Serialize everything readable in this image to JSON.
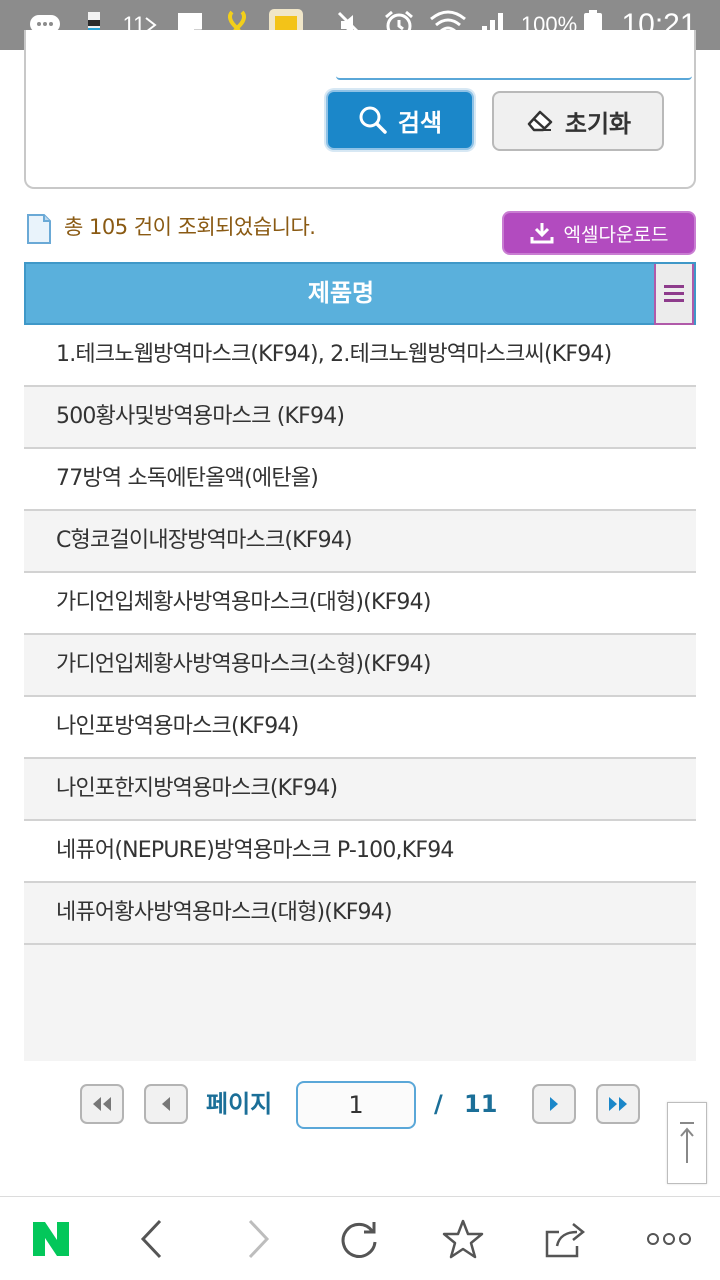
{
  "status_bar": {
    "carrier_badge": "11",
    "battery_percent": "100%",
    "time": "10:21"
  },
  "search": {
    "search_button": "검색",
    "reset_button": "초기화"
  },
  "results": {
    "summary": "총 105 건이 조회되었습니다.",
    "excel_button": "엑셀다운로드"
  },
  "table": {
    "header": "제품명",
    "rows": [
      "1.테크노웹방역마스크(KF94), 2.테크노웹방역마스크씨(KF94)",
      "500황사및방역용마스크 (KF94)",
      "77방역 소독에탄올액(에탄올)",
      "C형코걸이내장방역마스크(KF94)",
      "가디언입체황사방역용마스크(대형)(KF94)",
      "가디언입체황사방역용마스크(소형)(KF94)",
      "나인포방역용마스크(KF94)",
      "나인포한지방역용마스크(KF94)",
      "네퓨어(NEPURE)방역용마스크 P-100,KF94",
      "네퓨어황사방역용마스크(대형)(KF94)"
    ]
  },
  "pagination": {
    "page_label": "페이지",
    "current_page": "1",
    "separator": "/",
    "total_pages": "11"
  },
  "colors": {
    "accent_blue": "#1b87c9",
    "header_blue": "#5ab0dc",
    "excel_purple": "#b24bbf",
    "naver_green": "#03c75a"
  }
}
